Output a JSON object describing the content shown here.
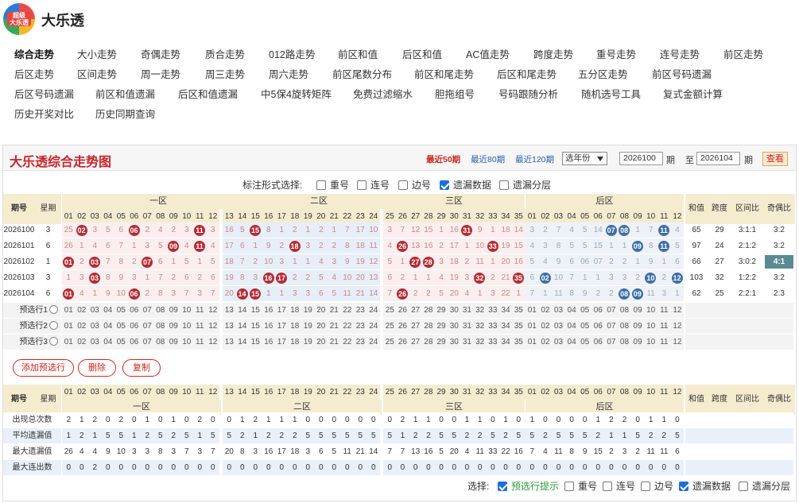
{
  "app": {
    "title": "大乐透",
    "logo_text": "超级\n大乐透"
  },
  "nav": [
    "综合走势",
    "大小走势",
    "奇偶走势",
    "质合走势",
    "012路走势",
    "前区和值",
    "后区和值",
    "AC值走势",
    "跨度走势",
    "重号走势",
    "连号走势",
    "前区走势",
    "后区走势",
    "区间走势",
    "周一走势",
    "周三走势",
    "周六走势",
    "前区尾数分布",
    "前区和尾走势",
    "后区和尾走势",
    "五分区走势",
    "前区号码遗漏",
    "后区号码遗漏",
    "前区和值遗漏",
    "后区和值遗漏",
    "中5保4旋转矩阵",
    "免费过滤缩水",
    "胆拖组号",
    "号码跟随分析",
    "随机选号工具",
    "复式金额计算",
    "历史开奖对比",
    "历史同期查询"
  ],
  "panel": {
    "title": "大乐透综合走势图",
    "ranges": [
      "最近50期",
      "最近80期",
      "最近120期"
    ],
    "year_select": "选年份",
    "from": "2026100",
    "to": "2026104",
    "qi": "期",
    "zhi": "至",
    "query": "查看"
  },
  "mark_options": {
    "label": "标注形式选择:",
    "items": [
      {
        "label": "重号",
        "checked": false
      },
      {
        "label": "连号",
        "checked": false
      },
      {
        "label": "边号",
        "checked": false
      },
      {
        "label": "遗漏数据",
        "checked": true
      },
      {
        "label": "遗漏分层",
        "checked": false
      }
    ]
  },
  "table": {
    "h_issue": "期号",
    "h_week": "星期",
    "zones": [
      "一区",
      "二区",
      "三区",
      "后区"
    ],
    "extra_headers": [
      "和值",
      "跨度",
      "区间比",
      "奇偶比"
    ],
    "front_nums": [
      "01",
      "02",
      "03",
      "04",
      "05",
      "06",
      "07",
      "08",
      "09",
      "10",
      "11",
      "12",
      "13",
      "14",
      "15",
      "16",
      "17",
      "18",
      "19",
      "20",
      "21",
      "22",
      "23",
      "24",
      "25",
      "26",
      "27",
      "28",
      "29",
      "30",
      "31",
      "32",
      "33",
      "34",
      "35"
    ],
    "back_nums": [
      "01",
      "02",
      "03",
      "04",
      "05",
      "06",
      "07",
      "08",
      "09",
      "10",
      "11",
      "12"
    ],
    "rows": [
      {
        "issue": "2026100",
        "week": "3",
        "front": [
          "25",
          "02",
          "3",
          "5",
          "6",
          "06",
          "2",
          "4",
          "2",
          "3",
          "11",
          "3",
          "16",
          "5",
          "15",
          "8",
          "1",
          "2",
          "1",
          "2",
          "1",
          "7",
          "17",
          "10",
          "3",
          "7",
          "12",
          "15",
          "1",
          "16",
          "31",
          "9",
          "1",
          "18",
          "14"
        ],
        "back": [
          "3",
          "2",
          "7",
          "4",
          "5",
          "14",
          "07",
          "08",
          "1",
          "7",
          "11",
          "4"
        ],
        "sum": "65",
        "span": "29",
        "ratio": "3:1:1",
        "oe": "3:2"
      },
      {
        "issue": "2026101",
        "week": "6",
        "front": [
          "26",
          "1",
          "4",
          "6",
          "7",
          "1",
          "3",
          "5",
          "09",
          "4",
          "11",
          "4",
          "17",
          "6",
          "1",
          "9",
          "2",
          "18",
          "3",
          "2",
          "2",
          "8",
          "18",
          "11",
          "4",
          "26",
          "13",
          "16",
          "2",
          "17",
          "1",
          "10",
          "33",
          "19",
          "15"
        ],
        "back": [
          "4",
          "3",
          "8",
          "5",
          "5",
          "15",
          "1",
          "1",
          "09",
          "8",
          "11",
          "5"
        ],
        "sum": "97",
        "span": "24",
        "ratio": "2:1:2",
        "oe": "3:2"
      },
      {
        "issue": "2026102",
        "week": "1",
        "front": [
          "01",
          "2",
          "03",
          "7",
          "8",
          "2",
          "07",
          "6",
          "1",
          "5",
          "1",
          "5",
          "18",
          "7",
          "2",
          "10",
          "3",
          "1",
          "1",
          "4",
          "3",
          "9",
          "19",
          "12",
          "5",
          "1",
          "27",
          "28",
          "3",
          "18",
          "2",
          "11",
          "1",
          "20",
          "16"
        ],
        "back": [
          "5",
          "4",
          "9",
          "6",
          "06",
          "07",
          "2",
          "2",
          "1",
          "9",
          "1",
          "6"
        ],
        "sum": "66",
        "span": "27",
        "ratio": "3:0:2",
        "oe": "4:1"
      },
      {
        "issue": "2026103",
        "week": "3",
        "front": [
          "1",
          "3",
          "03",
          "8",
          "9",
          "3",
          "1",
          "7",
          "2",
          "6",
          "2",
          "6",
          "19",
          "8",
          "3",
          "16",
          "17",
          "2",
          "2",
          "5",
          "4",
          "10",
          "20",
          "13",
          "6",
          "2",
          "1",
          "1",
          "4",
          "19",
          "3",
          "32",
          "2",
          "21",
          "35"
        ],
        "back": [
          "6",
          "02",
          "10",
          "7",
          "1",
          "1",
          "3",
          "3",
          "2",
          "10",
          "2",
          "12"
        ],
        "sum": "103",
        "span": "32",
        "ratio": "1:2:2",
        "oe": "3:2"
      },
      {
        "issue": "2026104",
        "week": "6",
        "front": [
          "01",
          "4",
          "1",
          "9",
          "10",
          "06",
          "2",
          "8",
          "3",
          "7",
          "3",
          "7",
          "20",
          "14",
          "15",
          "1",
          "1",
          "3",
          "3",
          "6",
          "5",
          "11",
          "21",
          "14",
          "7",
          "26",
          "2",
          "2",
          "5",
          "20",
          "4",
          "1",
          "3",
          "22",
          "1"
        ],
        "back": [
          "7",
          "1",
          "11",
          "8",
          "9",
          "2",
          "2",
          "08",
          "09",
          "11",
          "3",
          "1"
        ],
        "sum": "62",
        "span": "25",
        "ratio": "2:2:1",
        "oe": "2:3"
      }
    ],
    "presel": [
      "预选行1",
      "预选行2",
      "预选行3"
    ],
    "buttons": [
      "添加预选行",
      "删除",
      "复制"
    ],
    "stats": [
      {
        "label": "出现总次数",
        "front": [
          "2",
          "1",
          "2",
          "0",
          "2",
          "0",
          "1",
          "0",
          "1",
          "0",
          "2",
          "0",
          "0",
          "1",
          "2",
          "1",
          "1",
          "1",
          "0",
          "0",
          "0",
          "0",
          "0",
          "0",
          "0",
          "2",
          "1",
          "1",
          "0",
          "0",
          "1",
          "1",
          "0",
          "1",
          "0"
        ],
        "back": [
          "1",
          "0",
          "0",
          "0",
          "0",
          "1",
          "2",
          "2",
          "0",
          "1",
          "1",
          "0"
        ]
      },
      {
        "label": "平均遗漏值",
        "front": [
          "1",
          "2",
          "1",
          "5",
          "5",
          "1",
          "2",
          "5",
          "2",
          "5",
          "1",
          "5",
          "5",
          "2",
          "1",
          "2",
          "2",
          "2",
          "5",
          "5",
          "5",
          "5",
          "5",
          "5",
          "5",
          "1",
          "2",
          "2",
          "5",
          "5",
          "2",
          "2",
          "5",
          "2",
          "5"
        ],
        "back": [
          "5",
          "2",
          "5",
          "5",
          "5",
          "2",
          "1",
          "1",
          "5",
          "2",
          "2",
          "5"
        ]
      },
      {
        "label": "最大遗漏值",
        "front": [
          "26",
          "4",
          "4",
          "9",
          "10",
          "3",
          "3",
          "8",
          "3",
          "7",
          "3",
          "7",
          "20",
          "8",
          "3",
          "16",
          "17",
          "18",
          "3",
          "6",
          "5",
          "11",
          "21",
          "14",
          "7",
          "7",
          "13",
          "16",
          "5",
          "20",
          "4",
          "11",
          "33",
          "22",
          "16"
        ],
        "back": [
          "7",
          "4",
          "11",
          "8",
          "9",
          "15",
          "2",
          "3",
          "2",
          "11",
          "11",
          "6"
        ]
      },
      {
        "label": "最大连出数",
        "front": [
          "0",
          "0",
          "2",
          "0",
          "0",
          "0",
          "0",
          "0",
          "0",
          "0",
          "0",
          "0",
          "0",
          "0",
          "0",
          "0",
          "0",
          "0",
          "0",
          "0",
          "0",
          "0",
          "0",
          "0",
          "0",
          "0",
          "0",
          "0",
          "0",
          "0",
          "0",
          "0",
          "0",
          "0",
          "0"
        ],
        "back": [
          "0",
          "0",
          "0",
          "0",
          "0",
          "0",
          "0",
          "0",
          "0",
          "0",
          "0",
          "0"
        ]
      }
    ]
  },
  "bottom_options": {
    "label": "选择:",
    "items": [
      {
        "label": "预选行提示",
        "checked": true
      },
      {
        "label": "重号",
        "checked": false
      },
      {
        "label": "连号",
        "checked": false
      },
      {
        "label": "边号",
        "checked": false
      },
      {
        "label": "遗漏数据",
        "checked": true
      },
      {
        "label": "遗漏分层",
        "checked": false
      }
    ]
  },
  "colors": {
    "red_ball": "#b52b35",
    "blue_ball": "#3c6fa6",
    "accent": "#c9242b"
  }
}
